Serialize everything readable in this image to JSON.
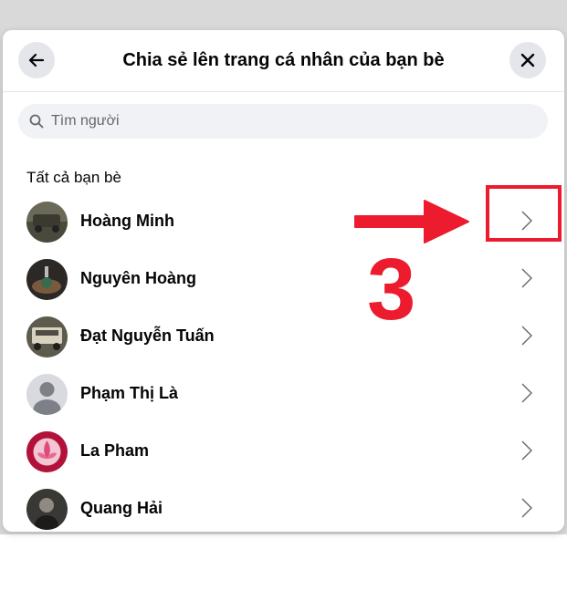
{
  "dialog": {
    "title": "Chia sẻ lên trang cá nhân của bạn bè",
    "back_icon": "arrow-left-icon",
    "close_icon": "close-icon"
  },
  "search": {
    "placeholder": "Tìm người",
    "value": "",
    "icon": "search-icon"
  },
  "section_label": "Tất cả bạn bè",
  "friends": [
    {
      "name": "Hoàng Minh",
      "avatar": "photo-car-avatar"
    },
    {
      "name": "Nguyên Hoàng",
      "avatar": "photo-dark-avatar"
    },
    {
      "name": "Đạt Nguyễn Tuấn",
      "avatar": "photo-truck-avatar"
    },
    {
      "name": "Phạm Thị Là",
      "avatar": "default-person-avatar"
    },
    {
      "name": "La Pham",
      "avatar": "lotus-avatar"
    },
    {
      "name": "Quang Hải",
      "avatar": "photo-portrait-avatar"
    }
  ],
  "annotation": {
    "step_number": "3",
    "color": "#ec1b2e"
  }
}
